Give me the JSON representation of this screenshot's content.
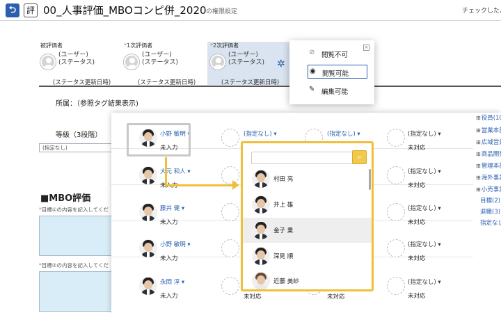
{
  "header": {
    "title": "00_人事評価_MBOコンピ併_2020",
    "subtitle": "の権限設定",
    "right_text": "チェックしたパ"
  },
  "evaluators": [
    {
      "role": "被評価者",
      "star": "",
      "user": "(ユーザー)",
      "status": "(ステータス)",
      "updated": "(ステータス更新日時)"
    },
    {
      "role": "1次評価者",
      "star": "*",
      "user": "(ユーザー)",
      "status": "(ステータス)",
      "updated": "(ステータス更新日時)"
    },
    {
      "role": "2次評価者",
      "star": "*",
      "user": "(ユーザー)",
      "status": "(ステータス)",
      "updated": "(ステータス更新日時)"
    }
  ],
  "page": {
    "affiliation": "所属：（参照タグ結果表示)",
    "grade": "等級（3段階）",
    "grade_value": "(指定なし)",
    "mbo_title": "■MBO評価",
    "goal1_label": "目標①の内容を記入してくだ",
    "goal2_label": "目標②の内容を記入してくだ"
  },
  "members": [
    {
      "name": "小野 敏明 ▾",
      "status": "未入力",
      "col2": "(指定なし) ▾",
      "col3": "(指定なし) ▾",
      "col4": "(指定なし) ▾",
      "col4_status": "未対応"
    },
    {
      "name": "大元 和人 ▾",
      "status": "未入力",
      "col2": "",
      "col3": "",
      "col4": "(指定なし) ▾",
      "col4_status": "未対応"
    },
    {
      "name": "藤井 健 ▾",
      "status": "未入力",
      "col2": "",
      "col3": "",
      "col4": "(指定なし) ▾",
      "col4_status": "未対応"
    },
    {
      "name": "小野 敏明 ▾",
      "status": "未入力",
      "col2": "",
      "col3": "",
      "col4": "(指定なし) ▾",
      "col4_status": "未対応"
    },
    {
      "name": "永岡 淳 ▾",
      "status": "未入力",
      "col2": "未対応",
      "col3": "未対応",
      "col4": "(指定なし) ▾",
      "col4_status": "未対応"
    }
  ],
  "selector": {
    "search_icon": "search-icon",
    "candidates": [
      "村田 亮",
      "井上 雄",
      "金子 乗",
      "深見 順",
      "近藤 美紗"
    ],
    "active_index": 2
  },
  "permissions": {
    "items": [
      {
        "label": "閲覧不可",
        "icon": "eye-off-icon"
      },
      {
        "label": "閲覧可能",
        "icon": "eye-icon"
      },
      {
        "label": "編集可能",
        "icon": "edit-icon"
      }
    ],
    "selected_index": 1,
    "close_icon": "close-icon"
  },
  "tree": [
    {
      "label": "役員(10",
      "plus": "⊞"
    },
    {
      "label": "営業本部",
      "plus": "⊞"
    },
    {
      "label": "広域営業",
      "plus": "⊞"
    },
    {
      "label": "商品開発",
      "plus": "⊞"
    },
    {
      "label": "管理本部",
      "plus": "⊞"
    },
    {
      "label": "海外事業",
      "plus": "⊞"
    },
    {
      "label": "小売事業",
      "plus": "⊞"
    },
    {
      "label": "目標(2)",
      "plus": ""
    },
    {
      "label": "退職(3)",
      "plus": ""
    },
    {
      "label": "指定なし",
      "plus": ""
    }
  ],
  "colors": {
    "accent": "#2a5fb0",
    "highlight": "#f0bf3a"
  }
}
